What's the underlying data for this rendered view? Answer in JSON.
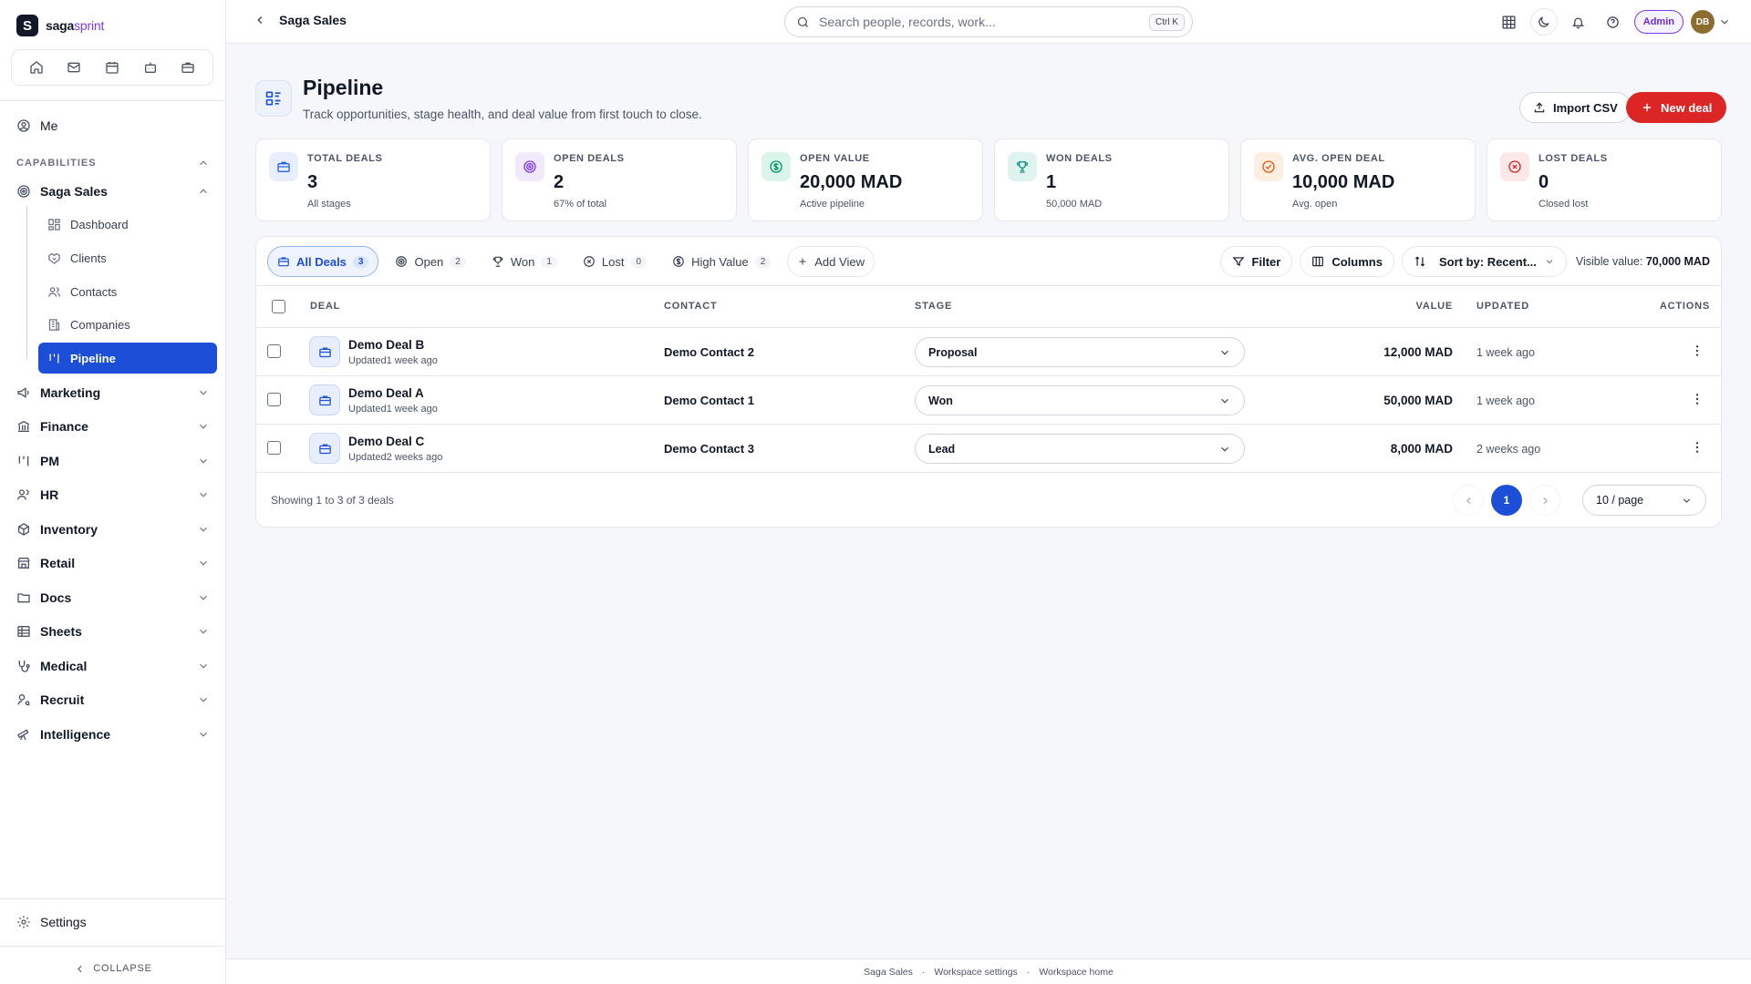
{
  "brand": {
    "logo_letter": "S",
    "name_part1": "saga",
    "name_part2": "sprint"
  },
  "sidebar": {
    "me_label": "Me",
    "capabilities_label": "CAPABILITIES",
    "active_group": "Saga Sales",
    "sub_items": [
      {
        "label": "Dashboard",
        "icon": "dashboard-icon"
      },
      {
        "label": "Clients",
        "icon": "handshake-icon"
      },
      {
        "label": "Contacts",
        "icon": "users-icon"
      },
      {
        "label": "Companies",
        "icon": "building-icon"
      },
      {
        "label": "Pipeline",
        "icon": "pipeline-icon",
        "active": true
      }
    ],
    "groups": [
      "Marketing",
      "Finance",
      "PM",
      "HR",
      "Inventory",
      "Retail",
      "Docs",
      "Sheets",
      "Medical",
      "Recruit",
      "Intelligence"
    ],
    "settings_label": "Settings",
    "collapse_label": "COLLAPSE"
  },
  "topbar": {
    "breadcrumb": "Saga Sales",
    "search_placeholder": "Search people, records, work...",
    "search_shortcut": "Ctrl K",
    "role_badge": "Admin",
    "avatar_initials": "DB"
  },
  "page": {
    "title": "Pipeline",
    "subtitle": "Track opportunities, stage health, and deal value from first touch to close.",
    "import_label": "Import CSV",
    "new_label": "New deal"
  },
  "stats": [
    {
      "label": "TOTAL DEALS",
      "value": "3",
      "sub": "All stages",
      "icon": "briefcase-icon",
      "color": "#2563eb",
      "bg": "#e8eefb"
    },
    {
      "label": "OPEN DEALS",
      "value": "2",
      "sub": "67% of total",
      "icon": "target-icon",
      "color": "#7c3aed",
      "bg": "#f1eafd"
    },
    {
      "label": "OPEN VALUE",
      "value": "20,000 MAD",
      "sub": "Active pipeline",
      "icon": "dollar-icon",
      "color": "#059669",
      "bg": "#dcf5ea"
    },
    {
      "label": "WON DEALS",
      "value": "1",
      "sub": "50,000 MAD",
      "icon": "trophy-icon",
      "color": "#0d9488",
      "bg": "#dff4ef"
    },
    {
      "label": "AVG. OPEN DEAL",
      "value": "10,000 MAD",
      "sub": "Avg. open",
      "icon": "check-circle-icon",
      "color": "#ea580c",
      "bg": "#fdeee2"
    },
    {
      "label": "LOST DEALS",
      "value": "0",
      "sub": "Closed lost",
      "icon": "x-circle-icon",
      "color": "#dc2626",
      "bg": "#fde8e8"
    }
  ],
  "views": [
    {
      "label": "All Deals",
      "count": "3",
      "active": true
    },
    {
      "label": "Open",
      "count": "2"
    },
    {
      "label": "Won",
      "count": "1"
    },
    {
      "label": "Lost",
      "count": "0"
    },
    {
      "label": "High Value",
      "count": "2"
    }
  ],
  "add_view_label": "Add View",
  "tools": {
    "filter_label": "Filter",
    "columns_label": "Columns",
    "sort_label": "Sort by: Recent...",
    "visible_label": "Visible value:",
    "visible_value": "70,000 MAD"
  },
  "table": {
    "headers": {
      "deal": "DEAL",
      "contact": "CONTACT",
      "stage": "STAGE",
      "value": "VALUE",
      "updated": "UPDATED",
      "actions": "ACTIONS"
    },
    "rows": [
      {
        "deal": "Demo Deal B",
        "updated_note": "Updated1 week ago",
        "contact": "Demo Contact 2",
        "stage": "Proposal",
        "value": "12,000 MAD",
        "updated": "1 week ago"
      },
      {
        "deal": "Demo Deal A",
        "updated_note": "Updated1 week ago",
        "contact": "Demo Contact 1",
        "stage": "Won",
        "value": "50,000 MAD",
        "updated": "1 week ago"
      },
      {
        "deal": "Demo Deal C",
        "updated_note": "Updated2 weeks ago",
        "contact": "Demo Contact 3",
        "stage": "Lead",
        "value": "8,000 MAD",
        "updated": "2 weeks ago"
      }
    ],
    "showing": "Showing 1 to 3 of 3 deals",
    "current_page": "1",
    "page_size": "10 / page"
  },
  "footer": {
    "link1": "Saga Sales",
    "link2": "Workspace settings",
    "link3": "Workspace home",
    "sep": "·"
  }
}
